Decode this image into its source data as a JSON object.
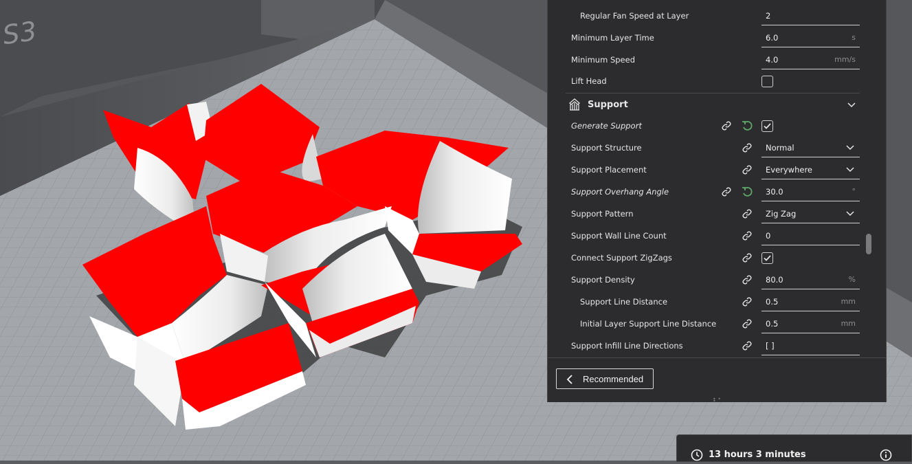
{
  "viewport": {
    "printer_brand": "S3",
    "model_colors": {
      "body": "#ff0000",
      "overhang": "#ffffff",
      "shadow": "#3d3e40"
    },
    "build_plate_color": "#9a9da1"
  },
  "settings": {
    "rows_top": [
      {
        "label": "Regular Fan Speed at Layer",
        "value": "2",
        "unit": ""
      },
      {
        "label": "Minimum Layer Time",
        "value": "6.0",
        "unit": "s"
      },
      {
        "label": "Minimum Speed",
        "value": "4.0",
        "unit": "mm/s"
      },
      {
        "label": "Lift Head",
        "checked": false
      }
    ],
    "support_section": {
      "title": "Support",
      "icon": "support-category-icon",
      "rows": [
        {
          "label": "Generate Support",
          "checked": true
        },
        {
          "label": "Support Structure",
          "value": "Normal"
        },
        {
          "label": "Support Placement",
          "value": "Everywhere"
        },
        {
          "label": "Support Overhang Angle",
          "value": "30.0",
          "unit": "°"
        },
        {
          "label": "Support Pattern",
          "value": "Zig Zag"
        },
        {
          "label": "Support Wall Line Count",
          "value": "0",
          "unit": ""
        },
        {
          "label": "Connect Support ZigZags",
          "checked": true
        },
        {
          "label": "Support Density",
          "value": "80.0",
          "unit": "%"
        },
        {
          "label": "Support Line Distance",
          "value": "0.5",
          "unit": "mm"
        },
        {
          "label": "Initial Layer Support Line Distance",
          "value": "0.5",
          "unit": "mm"
        },
        {
          "label": "Support Infill Line Directions",
          "value": "[ ]",
          "unit": ""
        }
      ]
    },
    "footer": {
      "recommended_label": "Recommended"
    }
  },
  "print_info": {
    "time": "13 hours 3 minutes"
  },
  "colors": {
    "panel_bg": "#2c2c2e",
    "reset_green": "#5ea86a",
    "text": "#e6e6e6"
  }
}
